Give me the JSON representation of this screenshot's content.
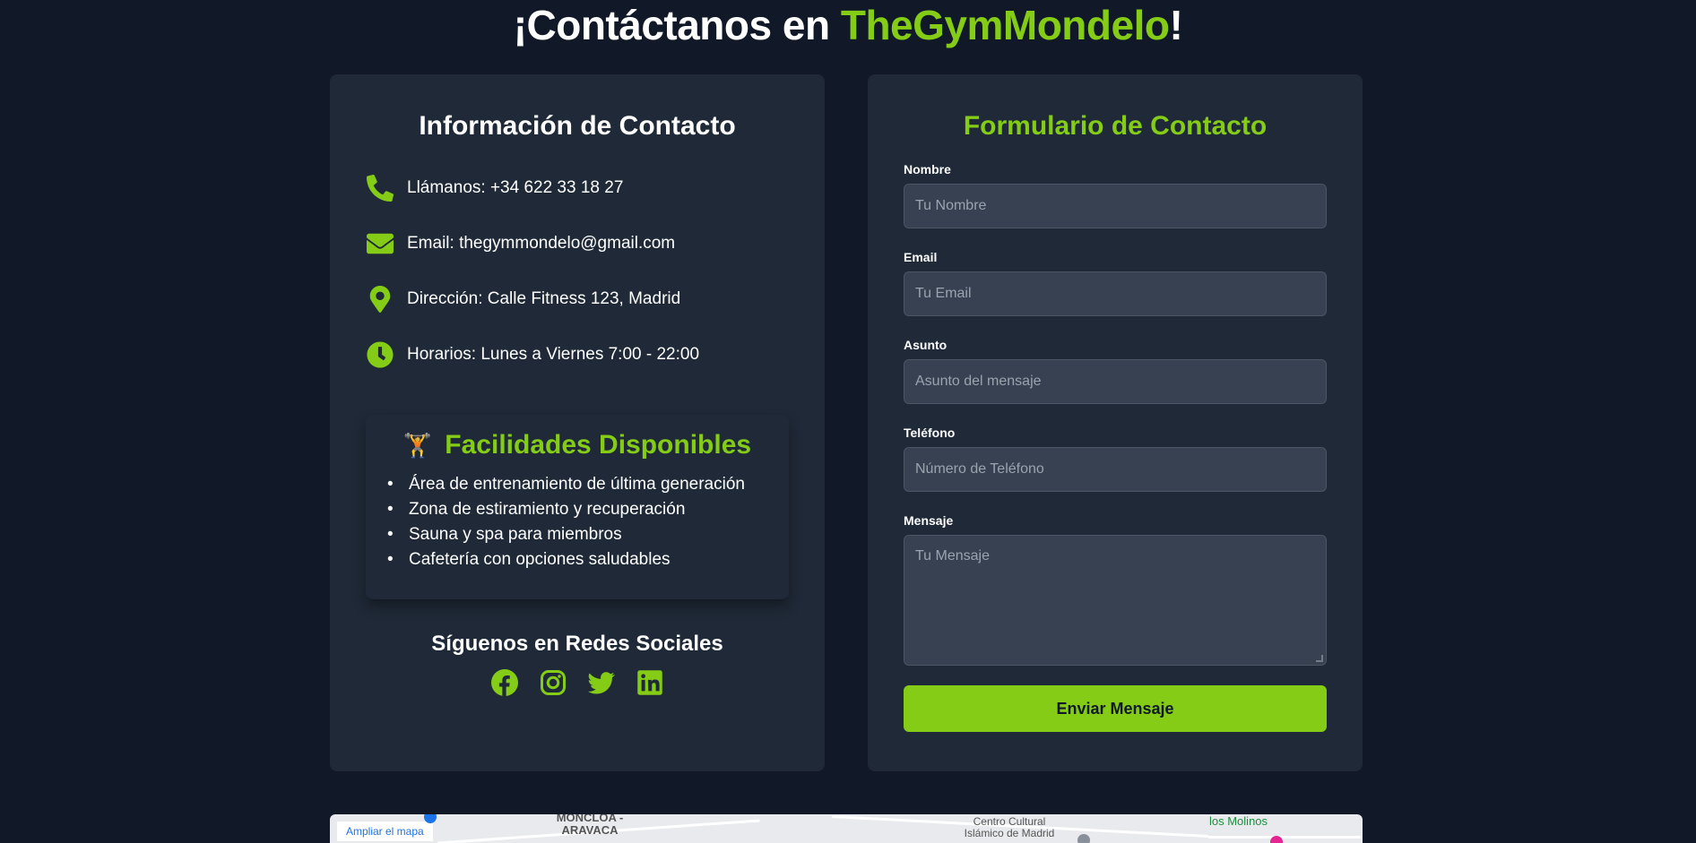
{
  "header": {
    "title_prefix": "¡Contáctanos en ",
    "title_brand": "TheGymMondelo",
    "title_suffix": "!"
  },
  "contact_info": {
    "heading": "Información de Contacto",
    "items": [
      {
        "icon": "phone-icon",
        "text": "Llámanos: +34 622 33 18 27"
      },
      {
        "icon": "envelope-icon",
        "text": "Email: thegymmondelo@gmail.com"
      },
      {
        "icon": "map-pin-icon",
        "text": "Dirección: Calle Fitness 123, Madrid"
      },
      {
        "icon": "clock-icon",
        "text": "Horarios: Lunes a Viernes 7:00 - 22:00"
      }
    ]
  },
  "facilities": {
    "emoji": "🏋️",
    "title": "Facilidades Disponibles",
    "items": [
      "Área de entrenamiento de última generación",
      "Zona de estiramiento y recuperación",
      "Sauna y spa para miembros",
      "Cafetería con opciones saludables"
    ]
  },
  "social": {
    "heading": "Síguenos en Redes Sociales",
    "icons": [
      "facebook-icon",
      "instagram-icon",
      "twitter-icon",
      "linkedin-icon"
    ]
  },
  "form": {
    "heading": "Formulario de Contacto",
    "fields": [
      {
        "label": "Nombre",
        "placeholder": "Tu Nombre"
      },
      {
        "label": "Email",
        "placeholder": "Tu Email"
      },
      {
        "label": "Asunto",
        "placeholder": "Asunto del mensaje"
      },
      {
        "label": "Teléfono",
        "placeholder": "Número de Teléfono"
      },
      {
        "label": "Mensaje",
        "placeholder": "Tu Mensaje"
      }
    ],
    "submit_label": "Enviar Mensaje"
  },
  "map": {
    "link_label": "Ampliar el mapa",
    "labels": [
      "MONCLOA - ARAVACA",
      "Centro Cultural Islámico de Madrid",
      "los Molinos"
    ]
  },
  "colors": {
    "accent": "#84cc16",
    "background": "#111827",
    "card": "#1f2937",
    "input": "#374151"
  }
}
